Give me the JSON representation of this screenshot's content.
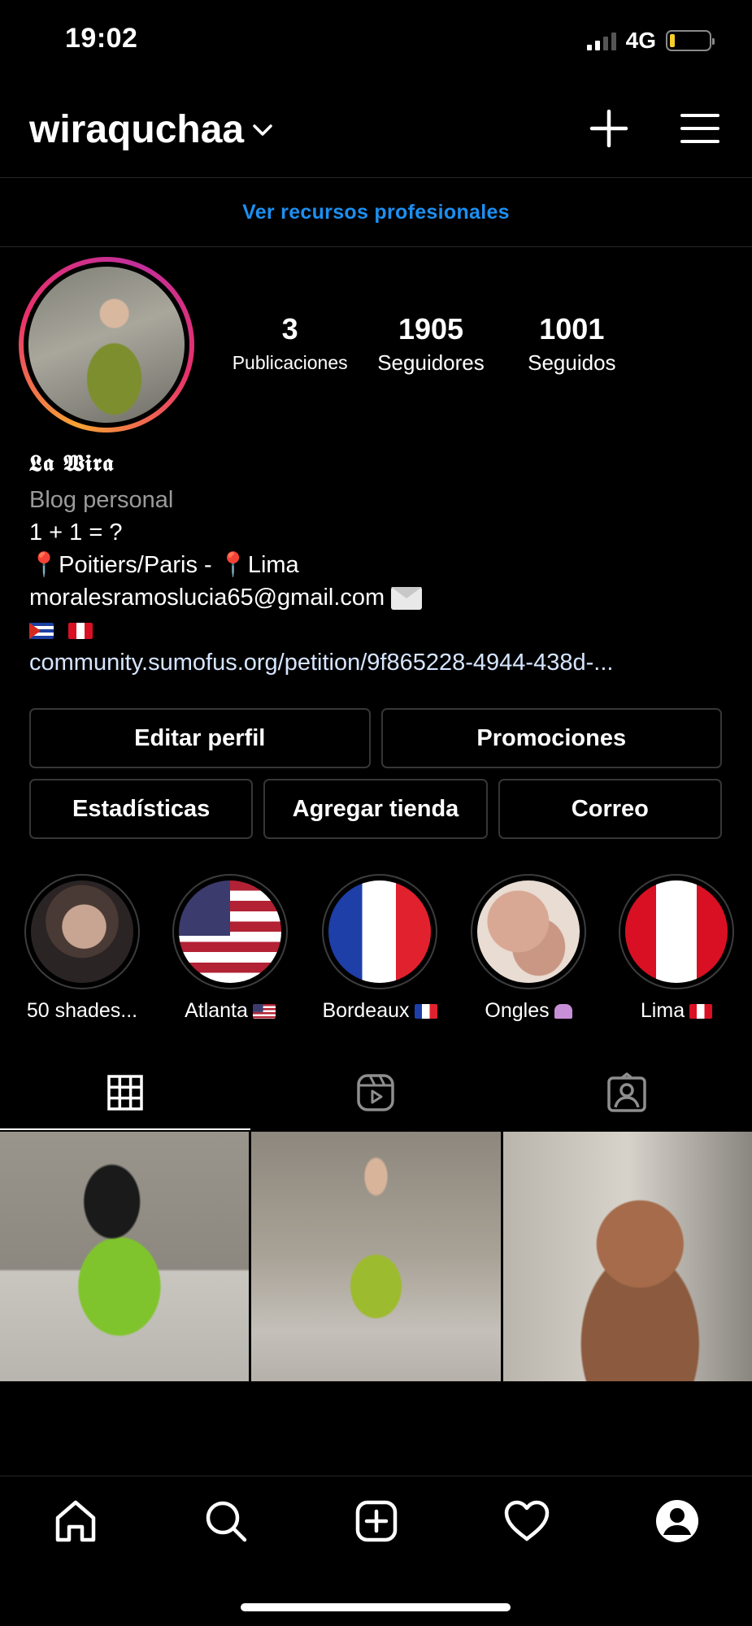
{
  "status": {
    "time": "19:02",
    "network": "4G",
    "battery_color": "#f7cf2a"
  },
  "header": {
    "username": "wiraquchaa",
    "icons": [
      "chevron-down-icon",
      "plus-icon",
      "menu-icon"
    ]
  },
  "pro_banner": {
    "label": "Ver recursos profesionales",
    "color": "#1d8ff0"
  },
  "profile": {
    "stats": [
      {
        "value": "3",
        "label": "Publicaciones"
      },
      {
        "value": "1905",
        "label": "Seguidores"
      },
      {
        "value": "1001",
        "label": "Seguidos"
      }
    ],
    "bio": {
      "name": "𝕷𝖆 𝖂𝖎𝖗𝖆",
      "category": "Blog personal",
      "line1": "1 + 1 = ?",
      "location_text": "Poitiers/Paris - ",
      "location_text2": "Lima",
      "email": "moralesramoslucia65@gmail.com",
      "link": "community.sumofus.org/petition/9f865228-4944-438d-..."
    }
  },
  "buttons": {
    "edit_profile": "Editar perfil",
    "promotions": "Promociones",
    "statistics": "Estadísticas",
    "add_shop": "Agregar tienda",
    "email": "Correo"
  },
  "highlights": [
    {
      "label": "50 shades..."
    },
    {
      "label": "Atlanta"
    },
    {
      "label": "Bordeaux"
    },
    {
      "label": "Ongles"
    },
    {
      "label": "Lima"
    }
  ],
  "tabs": [
    "grid-icon",
    "reels-icon",
    "tagged-icon"
  ],
  "bottom_nav": [
    "home-icon",
    "search-icon",
    "create-icon",
    "heart-icon",
    "profile-icon"
  ]
}
